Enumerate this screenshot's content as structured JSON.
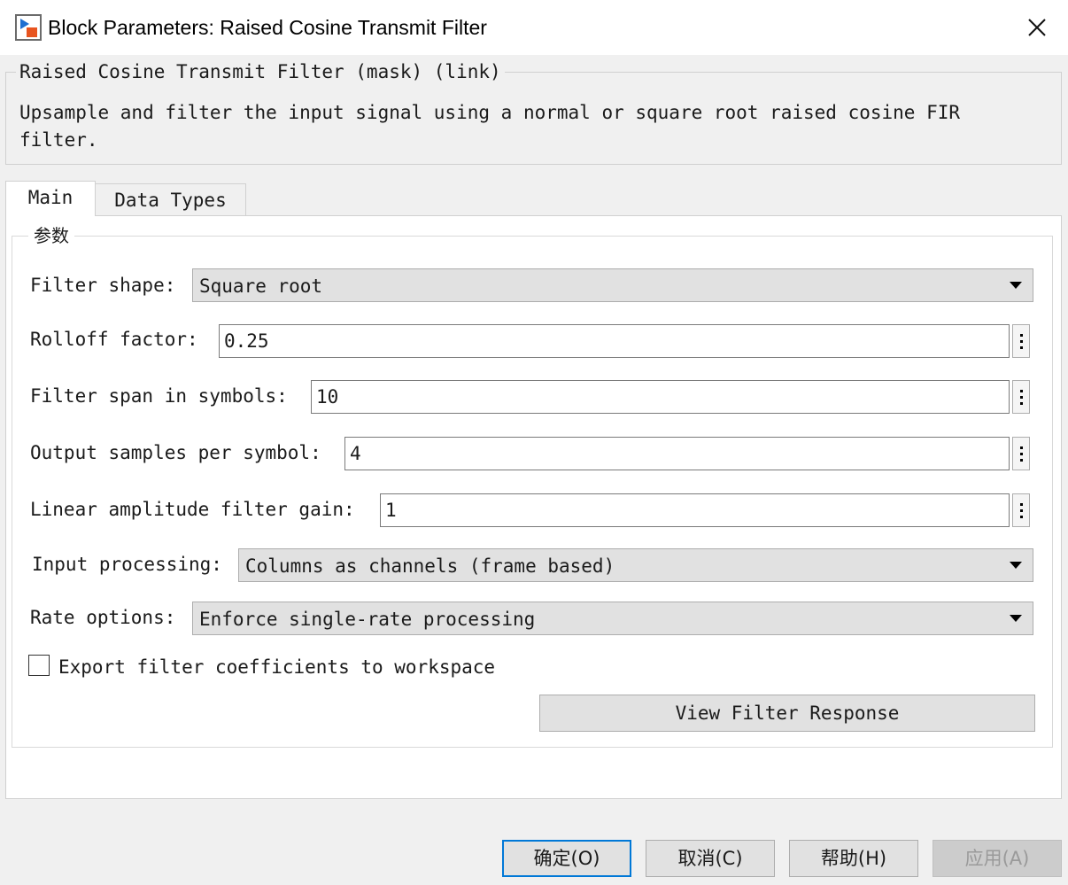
{
  "window": {
    "title": "Block Parameters: Raised Cosine Transmit Filter"
  },
  "description": {
    "group_title": "Raised Cosine Transmit Filter (mask) (link)",
    "text": "Upsample and filter the input signal using a normal or square root raised cosine FIR\nfilter."
  },
  "tabs": [
    {
      "label": "Main",
      "active": true
    },
    {
      "label": "Data Types",
      "active": false
    }
  ],
  "parameters": {
    "group_title": "参数",
    "filter_shape": {
      "label": "Filter shape:",
      "value": "Square root"
    },
    "rolloff_factor": {
      "label": "Rolloff factor:",
      "value": "0.25"
    },
    "filter_span": {
      "label": "Filter span in symbols:",
      "value": "10"
    },
    "output_samples": {
      "label": "Output samples per symbol:",
      "value": "4"
    },
    "filter_gain": {
      "label": "Linear amplitude filter gain:",
      "value": "1"
    },
    "input_processing": {
      "label": "Input processing:",
      "value": "Columns as channels (frame based)"
    },
    "rate_options": {
      "label": "Rate options:",
      "value": "Enforce single-rate processing"
    },
    "export_coefficients": {
      "label": "Export filter coefficients to workspace",
      "checked": false
    },
    "view_response_label": "View Filter Response"
  },
  "buttons": {
    "ok": "确定(O)",
    "cancel": "取消(C)",
    "help": "帮助(H)",
    "apply": "应用(A)"
  },
  "icons": {
    "app": "simulink-block-icon",
    "close": "close-icon",
    "more": "vertical-ellipsis-icon",
    "dropdown": "triangle-down-icon"
  },
  "colors": {
    "default_button_border": "#0078d7",
    "dialog_background": "#f0f0f0",
    "panel_background": "#ffffff",
    "control_background": "#e1e1e1"
  }
}
